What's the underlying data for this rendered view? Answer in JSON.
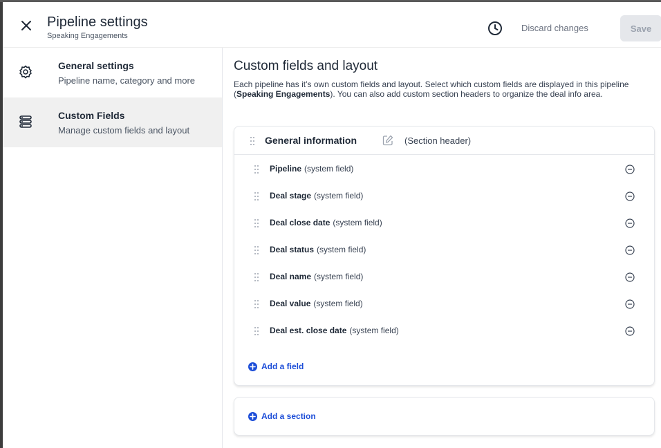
{
  "header": {
    "title": "Pipeline settings",
    "subtitle": "Speaking Engagements",
    "close_icon": "close-icon",
    "history_icon": "clock-icon",
    "discard_label": "Discard changes",
    "save_label": "Save"
  },
  "sidebar": {
    "items": [
      {
        "label": "General settings",
        "description": "Pipeline name, category and more",
        "icon": "gear-icon",
        "active": false
      },
      {
        "label": "Custom Fields",
        "description": "Manage custom fields and layout",
        "icon": "fields-icon",
        "active": true
      }
    ]
  },
  "main": {
    "title": "Custom fields and layout",
    "description_pre": "Each pipeline has it’s own custom fields and layout. Select which custom fields are displayed in this pipeline (",
    "description_pipeline": "Speaking Engagements",
    "description_post": "). You can also add custom section headers to organize the deal info area.",
    "section": {
      "title": "General information",
      "tag": "(Section header)"
    },
    "fields": [
      {
        "name": "Pipeline",
        "tag": "(system field)"
      },
      {
        "name": "Deal stage",
        "tag": "(system field)"
      },
      {
        "name": "Deal close date",
        "tag": "(system field)"
      },
      {
        "name": "Deal status",
        "tag": "(system field)"
      },
      {
        "name": "Deal name",
        "tag": "(system field)"
      },
      {
        "name": "Deal value",
        "tag": "(system field)"
      },
      {
        "name": "Deal est. close date",
        "tag": "(system field)"
      }
    ],
    "add_field_label": "Add a field",
    "add_section_label": "Add a section"
  },
  "colors": {
    "accent": "#1d4ed8",
    "active_sidebar": "#f0f0f0",
    "save_disabled": "#e5e7eb"
  }
}
